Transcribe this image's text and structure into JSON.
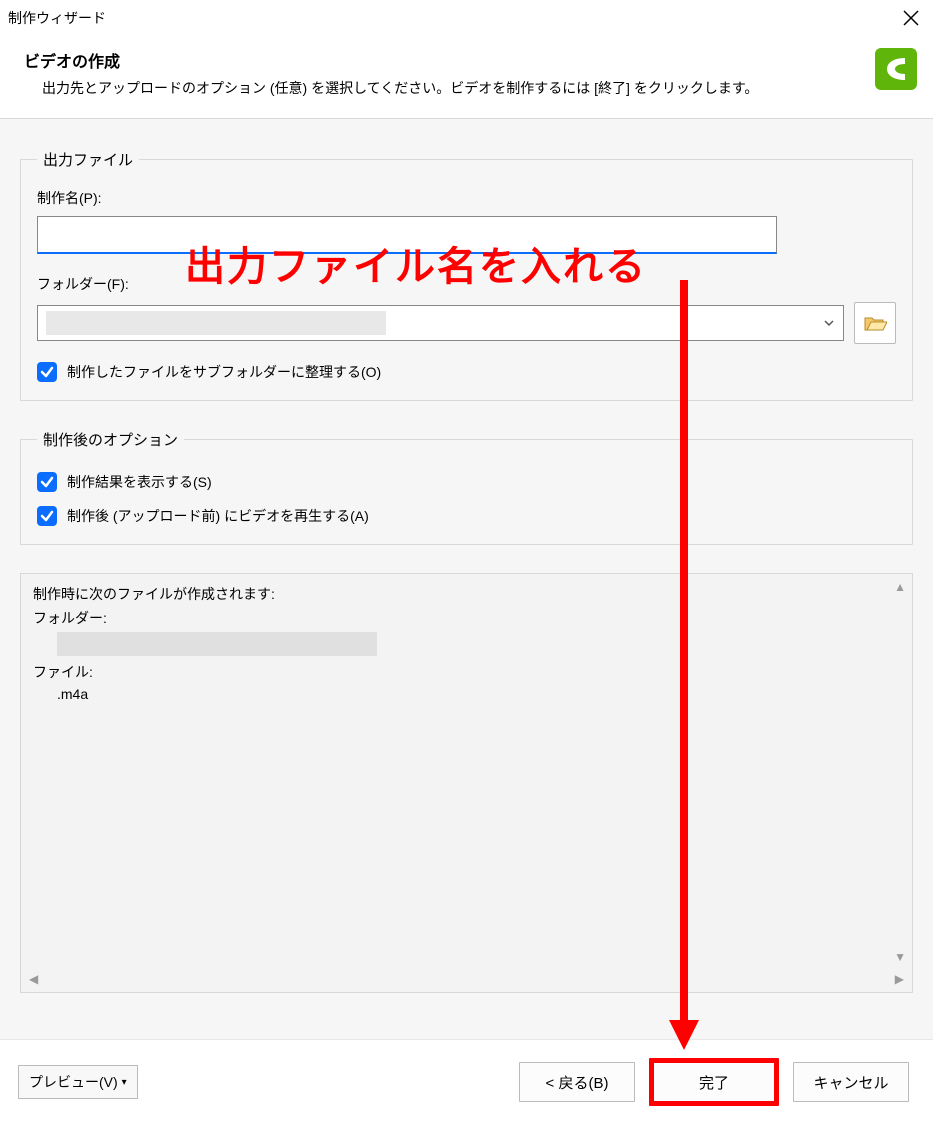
{
  "window": {
    "title": "制作ウィザード"
  },
  "header": {
    "heading": "ビデオの作成",
    "desc": "出力先とアップロードのオプション (任意) を選択してください。ビデオを制作するには [終了] をクリックします。"
  },
  "output_file_group": {
    "legend": "出力ファイル",
    "production_name_label": "制作名(P):",
    "production_name_value": "",
    "folder_label": "フォルダー(F):",
    "folder_value": "",
    "organize_subfolders_label": "制作したファイルをサブフォルダーに整理する(O)"
  },
  "post_group": {
    "legend": "制作後のオプション",
    "show_results_label": "制作結果を表示する(S)",
    "play_after_label": "制作後 (アップロード前) にビデオを再生する(A)"
  },
  "output_panel": {
    "intro": "制作時に次のファイルが作成されます:",
    "folder_label": "フォルダー:",
    "file_label": "ファイル:",
    "file_item": ".m4a"
  },
  "buttons": {
    "preview": "プレビュー(V)",
    "back": "< 戻る(B)",
    "finish": "完了",
    "cancel": "キャンセル"
  },
  "annotations": {
    "text": "出力ファイル名を入れる"
  }
}
